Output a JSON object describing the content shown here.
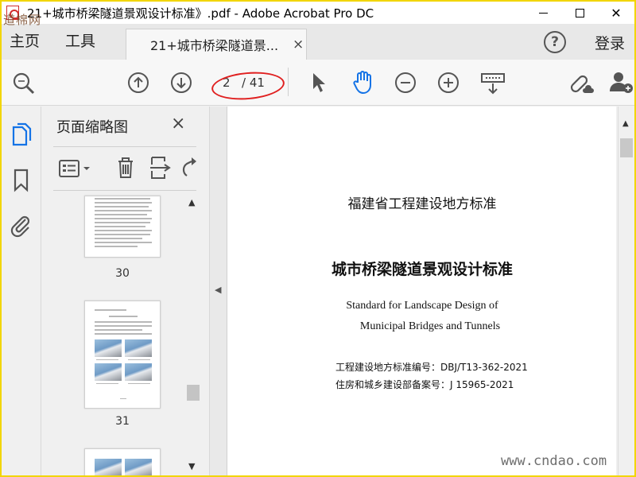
{
  "window": {
    "title": "21+城市桥梁隧道景观设计标准》.pdf - Adobe Acrobat Pro DC",
    "minimize_label": "—",
    "close_label": "✕"
  },
  "watermarks": {
    "top_left": "道棉网",
    "bottom_right": "www.cndao.com"
  },
  "menubar": {
    "home": "主页",
    "tools": "工具",
    "tab_label": "21+城市桥梁隧道景...",
    "tab_close": "×",
    "help": "?",
    "login": "登录"
  },
  "toolbar": {
    "current_page": "2",
    "total_pages": "/ 41",
    "icons": [
      "search-zoom-icon",
      "page-up-icon",
      "page-down-icon",
      "select-arrow-icon",
      "hand-tool-icon",
      "zoom-out-icon",
      "zoom-in-icon",
      "keyboard-scroll-icon",
      "share-link-icon",
      "add-user-icon"
    ]
  },
  "sidebar": {
    "panel_title": "页面缩略图",
    "panel_close": "×",
    "rail_icons": [
      "page-thumbnails-icon",
      "bookmark-icon",
      "attachment-icon"
    ],
    "thumbnails": [
      {
        "label": "30"
      },
      {
        "label": "31"
      },
      {
        "label": ""
      }
    ]
  },
  "document": {
    "heading_org": "福建省工程建设地方标准",
    "heading_title": "城市桥梁隧道景观设计标准",
    "english_line1": "Standard for Landscape Design of",
    "english_line2": "Municipal Bridges and Tunnels",
    "standard_no": "工程建设地方标准编号：DBJ/T13-362-2021",
    "record_no": "住房和城乡建设部备案号：J 15965-2021"
  },
  "colors": {
    "accent_blue": "#1473e6",
    "annotation_red": "#e02020",
    "frame_yellow": "#f2d500"
  }
}
